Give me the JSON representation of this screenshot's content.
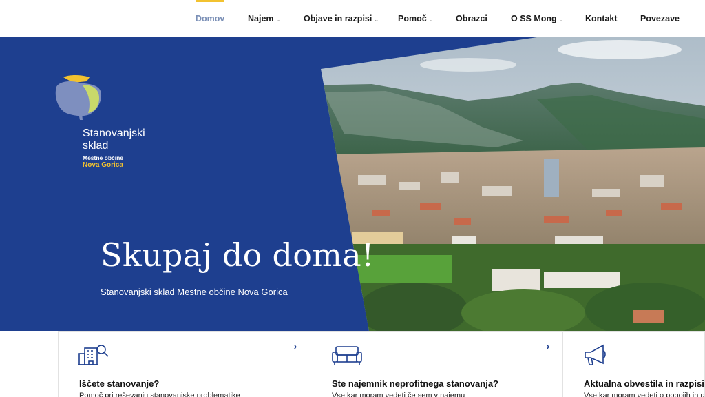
{
  "nav": {
    "items": [
      {
        "label": "Domov",
        "dropdown": false,
        "active": true
      },
      {
        "label": "Najem",
        "dropdown": true,
        "active": false
      },
      {
        "label": "Objave in razpisi",
        "dropdown": true,
        "active": false
      },
      {
        "label": "Pomoč",
        "dropdown": true,
        "active": false
      },
      {
        "label": "Obrazci",
        "dropdown": false,
        "active": false
      },
      {
        "label": "O SS Mong",
        "dropdown": true,
        "active": false
      },
      {
        "label": "Kontakt",
        "dropdown": false,
        "active": false
      },
      {
        "label": "Povezave",
        "dropdown": false,
        "active": false
      }
    ],
    "chevron": "chevron-down-icon",
    "active_color": "#7a8fb6",
    "indicator_color": "#f2c230"
  },
  "brand": {
    "line1": "Stanovanjski",
    "line2": "sklad",
    "sub": "Mestne občine",
    "town": "Nova Gorica",
    "logo_icon": "tree-logo-icon"
  },
  "hero": {
    "title": "Skupaj do doma!",
    "subtitle": "Stanovanjski sklad Mestne občine Nova Gorica",
    "background": "#1e3f8f",
    "photo": "city-mountain-panorama"
  },
  "cards": [
    {
      "title": "Iščete stanovanje?",
      "desc": "Pomoč pri reševanju stanovanjske problematike",
      "icon": "building-search-icon",
      "arrow": "›"
    },
    {
      "title": "Ste najemnik neprofitnega stanovanja?",
      "desc": "Vse kar moram vedeti če sem v najemu",
      "icon": "sofa-icon",
      "arrow": "›"
    },
    {
      "title": "Aktualna obvestila in razpisi",
      "desc": "Vse kar moram vedeti o pogojih in razpisih",
      "icon": "megaphone-icon",
      "arrow": "›"
    }
  ]
}
